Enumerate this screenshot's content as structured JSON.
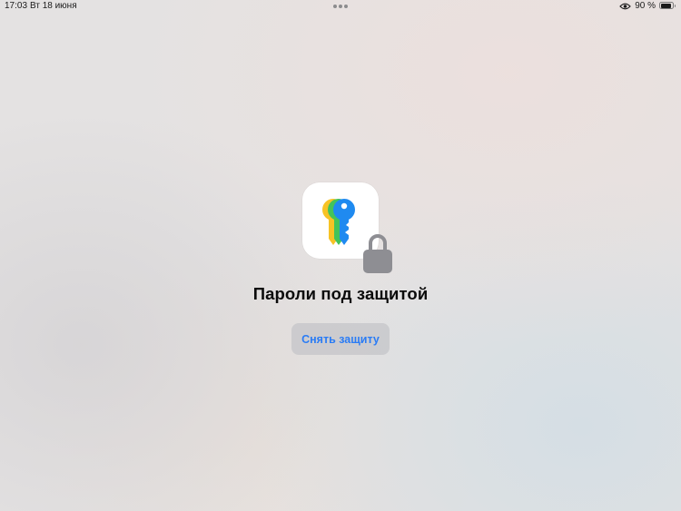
{
  "status_bar": {
    "time": "17:03",
    "date": "Вт 18 июня",
    "battery_percent": "90 %",
    "battery_level": 0.9,
    "icons": [
      "vpn-icon",
      "battery-icon"
    ]
  },
  "app": {
    "icon": "passwords-keys-icon",
    "lock_icon": "lock-icon",
    "title": "Пароли под защитой",
    "unlock_button_label": "Снять защиту"
  },
  "colors": {
    "accent": "#2a7cf5",
    "key_yellow": "#f7c325",
    "key_green": "#43c35a",
    "key_blue": "#1f8af0",
    "lock_gray": "#8e8e93"
  }
}
